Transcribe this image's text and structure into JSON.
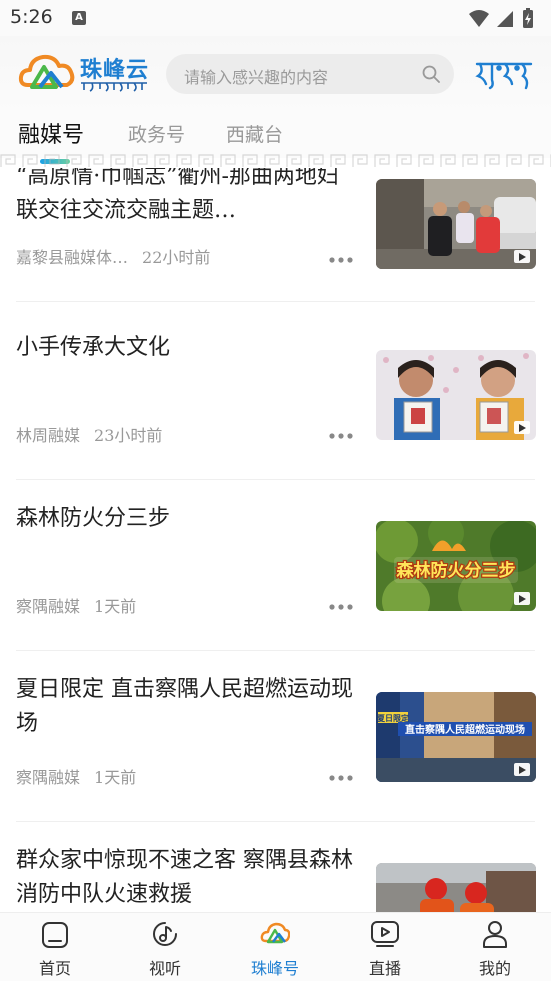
{
  "status_bar": {
    "time": "5:26",
    "notification_letter": "A",
    "icons": [
      "wifi-icon",
      "signal-icon",
      "battery-icon"
    ]
  },
  "header": {
    "app_name": "珠峰云",
    "search_placeholder": "请输入感兴趣的内容",
    "language_toggle_icon": "tibetan-script-icon"
  },
  "tabs": [
    {
      "label": "融媒号",
      "active": true
    },
    {
      "label": "政务号",
      "active": false
    },
    {
      "label": "西藏台",
      "active": false
    }
  ],
  "feed": [
    {
      "title": "“高原情·巾帼志”衢州-那曲两地妇联交往交流交融主题…",
      "source": "嘉黎县融媒体…",
      "time": "22小时前",
      "has_video": true,
      "thumb_icon": "street-scene-thumbnail"
    },
    {
      "title": "小手传承大文化",
      "source": "林周融媒",
      "time": "23小时前",
      "has_video": true,
      "thumb_icon": "children-holding-art-thumbnail"
    },
    {
      "title": "森林防火分三步",
      "source": "察隅融媒",
      "time": "1天前",
      "has_video": true,
      "thumb_icon": "forest-fire-thumbnail",
      "thumb_caption": "森林防火分三步"
    },
    {
      "title": "夏日限定 直击察隅人民超燃运动现场",
      "source": "察隅融媒",
      "time": "1天前",
      "has_video": true,
      "thumb_icon": "sports-event-thumbnail",
      "thumb_caption": "直击察隅人民超燃运动现场",
      "thumb_tag": "夏日限定"
    },
    {
      "title": "群众家中惊现不速之客 察隅县森林消防中队火速救援",
      "source": "",
      "time": "",
      "has_video": false,
      "thumb_icon": "firefighters-thumbnail"
    }
  ],
  "bottom_nav": [
    {
      "label": "首页",
      "icon": "home-icon",
      "active": false
    },
    {
      "label": "视听",
      "icon": "music-note-icon",
      "active": false
    },
    {
      "label": "珠峰号",
      "icon": "zhufeng-logo-icon",
      "active": true
    },
    {
      "label": "直播",
      "icon": "live-play-icon",
      "active": false
    },
    {
      "label": "我的",
      "icon": "profile-icon",
      "active": false
    }
  ],
  "colors": {
    "accent": "#1f7fd1",
    "brand_green": "#4bb84a",
    "brand_orange": "#f08a24",
    "meta_gray": "#999999"
  }
}
